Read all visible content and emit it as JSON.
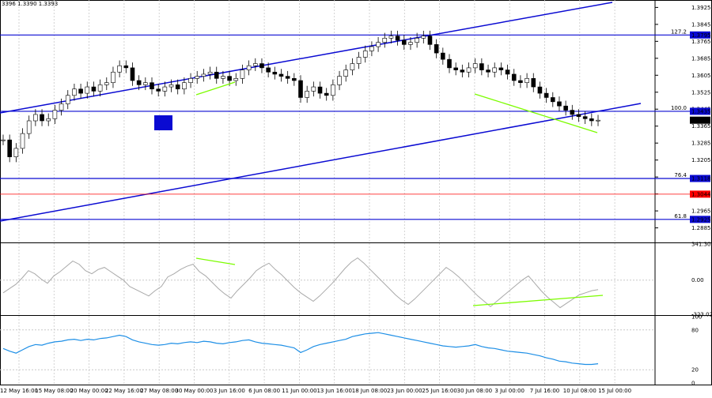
{
  "header": {
    "ohlc_text": "3396 1.3390 1.3393"
  },
  "colors": {
    "grid": "#c8c8c8",
    "channel": "#0a0ad2",
    "level": "#0a0ad2",
    "red_level": "#ff0000",
    "divergence": "#7cfc00",
    "cci": "#a9a9a9",
    "rsi": "#1e8fe6",
    "price_tag": "#000000"
  },
  "chart_data": [
    {
      "type": "line",
      "name": "price",
      "ylim": [
        1.282,
        1.396
      ],
      "y_ticks": [
        "1.3925",
        "1.3845",
        "1.3765",
        "1.3685",
        "1.3605",
        "1.3525",
        "1.3445",
        "1.3365",
        "1.3285",
        "1.3205",
        "1.3125",
        "1.3045",
        "1.2965",
        "1.2885"
      ],
      "time_labels": [
        "12 May 16:00",
        "15 May 08:00",
        "20 May 00:00",
        "22 May 16:00",
        "27 May 08:00",
        "30 May 00:00",
        "3 Jun 16:00",
        "6 Jun 08:00",
        "11 Jun 00:00",
        "13 Jun 16:00",
        "18 Jun 08:00",
        "23 Jun 00:00",
        "25 Jun 16:00",
        "30 Jun 08:00",
        "3 Jul 00:00",
        "7 Jul 16:00",
        "10 Jul 08:00",
        "15 Jul 00:00"
      ],
      "bar_range": [
        0,
        100
      ],
      "x_labels_at": [
        0,
        6,
        12,
        18,
        24,
        30,
        36,
        42,
        48,
        54,
        60,
        66,
        72,
        78,
        84,
        90,
        96,
        102
      ],
      "close": [
        1.33,
        1.322,
        1.326,
        1.333,
        1.339,
        1.342,
        1.339,
        1.34,
        1.344,
        1.347,
        1.351,
        1.354,
        1.352,
        1.355,
        1.353,
        1.356,
        1.357,
        1.362,
        1.365,
        1.364,
        1.358,
        1.356,
        1.357,
        1.354,
        1.353,
        1.355,
        1.356,
        1.354,
        1.357,
        1.359,
        1.36,
        1.361,
        1.362,
        1.359,
        1.36,
        1.358,
        1.359,
        1.363,
        1.365,
        1.366,
        1.364,
        1.362,
        1.361,
        1.36,
        1.359,
        1.358,
        1.35,
        1.353,
        1.355,
        1.352,
        1.351,
        1.356,
        1.36,
        1.363,
        1.366,
        1.369,
        1.372,
        1.374,
        1.376,
        1.378,
        1.379,
        1.377,
        1.375,
        1.376,
        1.378,
        1.379,
        1.375,
        1.371,
        1.368,
        1.364,
        1.363,
        1.362,
        1.364,
        1.366,
        1.363,
        1.362,
        1.364,
        1.363,
        1.361,
        1.358,
        1.357,
        1.359,
        1.355,
        1.352,
        1.35,
        1.348,
        1.346,
        1.344,
        1.342,
        1.341,
        1.34,
        1.339,
        1.3393
      ],
      "levels": [
        {
          "label": "127.2",
          "value": 1.3795,
          "tag": "1.3795",
          "color": "level"
        },
        {
          "label": "100.0",
          "value": 1.3435,
          "tag": "1.3435",
          "color": "level"
        },
        {
          "label": "",
          "value": 1.3393,
          "tag": "1.3393",
          "color": "price_tag"
        },
        {
          "label": "76.4",
          "value": 1.3118,
          "tag": "1.3118",
          "color": "level"
        },
        {
          "label": "",
          "value": 1.3044,
          "tag": "1.3044",
          "color": "red_level"
        },
        {
          "label": "61.8",
          "value": 1.2925,
          "tag": "1.2925",
          "color": "level"
        }
      ]
    },
    {
      "type": "line",
      "name": "cci",
      "y_ticks": [
        "341.3079",
        "0.00",
        "-323.021"
      ],
      "values": [
        -120,
        -80,
        -40,
        20,
        90,
        60,
        10,
        -30,
        40,
        80,
        130,
        180,
        150,
        90,
        60,
        100,
        120,
        80,
        40,
        0,
        -60,
        -90,
        -120,
        -150,
        -100,
        -60,
        30,
        60,
        100,
        130,
        150,
        80,
        40,
        -20,
        -80,
        -130,
        -170,
        -100,
        -40,
        20,
        90,
        130,
        160,
        100,
        50,
        -10,
        -70,
        -120,
        -160,
        -200,
        -150,
        -90,
        -30,
        40,
        110,
        170,
        210,
        160,
        100,
        40,
        -20,
        -80,
        -140,
        -190,
        -230,
        -180,
        -120,
        -60,
        0,
        60,
        120,
        80,
        30,
        -30,
        -90,
        -150,
        -200,
        -250,
        -200,
        -150,
        -100,
        -50,
        0,
        40,
        -30,
        -100,
        -160,
        -210,
        -260,
        -220,
        -180,
        -140,
        -120,
        -100,
        -90
      ]
    },
    {
      "type": "line",
      "name": "rsi",
      "y_ticks": [
        "100",
        "80",
        "20",
        "0"
      ],
      "ylim": [
        0,
        100
      ],
      "values": [
        52,
        48,
        45,
        50,
        55,
        58,
        57,
        60,
        62,
        63,
        65,
        66,
        64,
        66,
        65,
        67,
        68,
        70,
        72,
        70,
        65,
        62,
        60,
        58,
        57,
        58,
        60,
        59,
        61,
        62,
        61,
        63,
        62,
        60,
        59,
        61,
        62,
        64,
        65,
        62,
        60,
        59,
        58,
        57,
        55,
        53,
        46,
        50,
        55,
        58,
        60,
        62,
        64,
        66,
        70,
        72,
        74,
        75,
        76,
        74,
        72,
        70,
        68,
        66,
        64,
        62,
        60,
        58,
        56,
        55,
        54,
        55,
        56,
        58,
        55,
        53,
        52,
        50,
        48,
        47,
        46,
        45,
        43,
        41,
        38,
        36,
        33,
        32,
        30,
        29,
        28,
        28,
        29
      ]
    }
  ]
}
